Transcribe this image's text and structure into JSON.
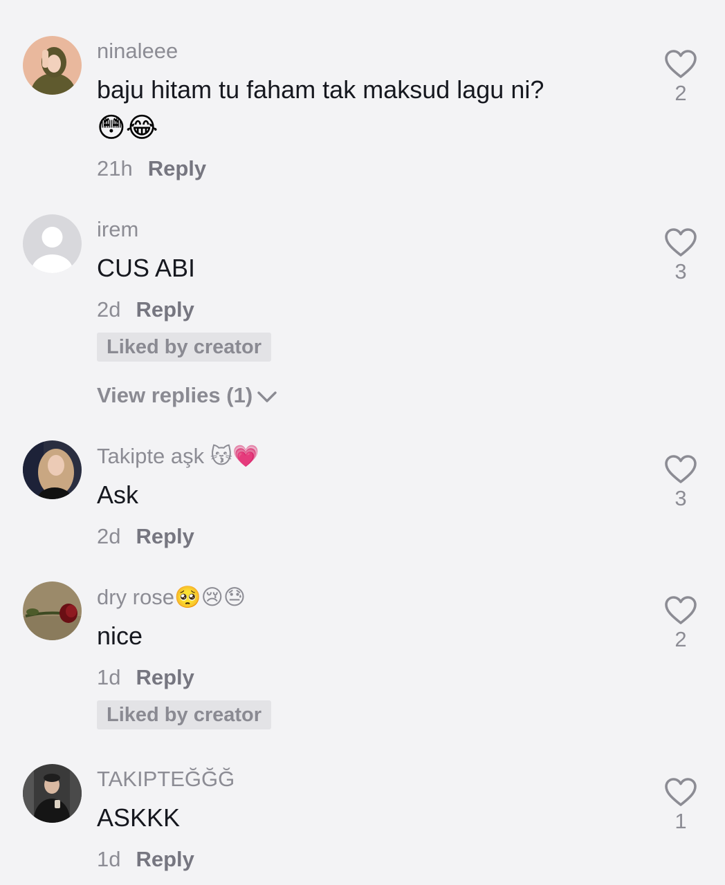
{
  "comments": [
    {
      "username": "ninaleee",
      "text": "baju hitam tu faham tak maksud lagu ni?",
      "emoji_line": "😳😂",
      "time": "21h",
      "reply_label": "Reply",
      "likes": "2"
    },
    {
      "username": "irem",
      "text": "CUS ABI",
      "time": "2d",
      "reply_label": "Reply",
      "badge": "Liked by creator",
      "view_replies": "View replies (1)",
      "likes": "3"
    },
    {
      "username": "Takipte aşk 😽💗",
      "text": "Ask",
      "time": "2d",
      "reply_label": "Reply",
      "likes": "3"
    },
    {
      "username": "dry rose🥺😢😓",
      "text": "nice",
      "time": "1d",
      "reply_label": "Reply",
      "badge": "Liked by creator",
      "likes": "2"
    },
    {
      "username": "TAKIPTEĞĞĞ",
      "text": "ASKKK",
      "time": "1d",
      "reply_label": "Reply",
      "likes": "1"
    }
  ],
  "icons": {
    "like": "heart-outline-icon",
    "expand": "chevron-down-icon"
  },
  "colors": {
    "background": "#f3f3f5",
    "text_primary": "#16181f",
    "text_secondary": "#8c8c94",
    "badge_bg": "#e3e3e6"
  }
}
